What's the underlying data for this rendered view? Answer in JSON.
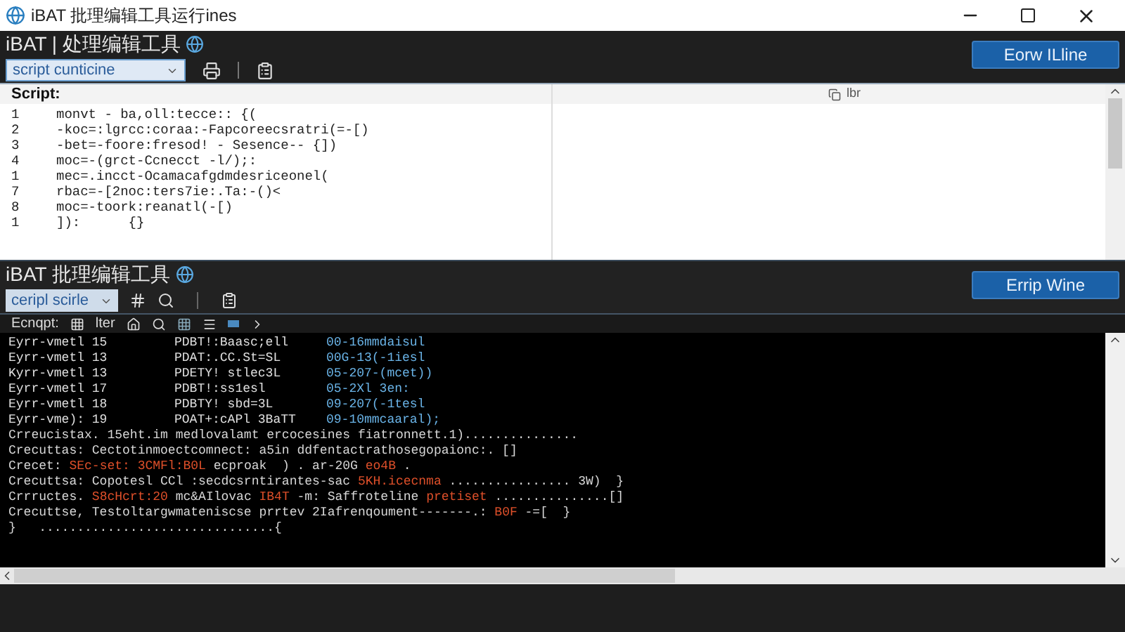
{
  "window": {
    "title": "iBAT 批理编辑工具运行ines"
  },
  "header": {
    "title": "iBAT | 处理编辑工具",
    "button": "Eorw ILline",
    "dropdown": "script cunticine"
  },
  "editor": {
    "label": "Script:",
    "side_label": "lbr",
    "lines": [
      {
        "number": "1",
        "code": "monvt - ba,oll:tecce:: {("
      },
      {
        "number": "2",
        "code": "-koc=:lgrcc:coraa:-Fapcoreecsratri(=-[)"
      },
      {
        "number": "3",
        "code": "-bet=-foore:fresod! - Sesence-- {])"
      },
      {
        "number": "4",
        "code": "moc=-(grct-Ccnecct -l/);:"
      },
      {
        "number": "1",
        "code": "mec=.incct-Ocamacafgdmdesriceonel("
      },
      {
        "number": "7",
        "code": "rbac=-[2noc:ters7ie:.Ta:-()<"
      },
      {
        "number": "8",
        "code": "moc=-toork:reanatl(-[)"
      },
      {
        "number": "1",
        "code": "]):      {}"
      }
    ]
  },
  "console_panel": {
    "title": "iBAT 批理编辑工具",
    "dropdown": "ceripl scirle",
    "button": "Errip Wine",
    "toolbar_label": "Ecnqpt:",
    "filter_label": "lter",
    "rows": [
      {
        "cells": [
          "Eyrr-vmetl 15",
          "PDBT!:Baasc;ell",
          "00-16mmdaisul"
        ]
      },
      {
        "cells": [
          "Eyrr-vmetl 13",
          "PDAT:.CC.St=SL",
          "00G-13(-1iesl"
        ]
      },
      {
        "cells": [
          "Kyrr-vmetl 13",
          "PDETY! stlec3L",
          "05-207-(mcet))"
        ]
      },
      {
        "cells": [
          "Eyrr-vmetl 17",
          "PDBT!:ss1esl",
          "05-2Xl 3en:"
        ]
      },
      {
        "cells": [
          "Eyrr-vmetl 18",
          "PDBTY! sbd=3L",
          "09-207(-1tesl"
        ]
      },
      {
        "cells": [
          "Eyrr-vme): 19",
          "POAT+:cAPl 3BaTT",
          "09-10mmcaaral);"
        ]
      }
    ],
    "lines": [
      {
        "segments": [
          {
            "text": "Crreucistax. 15eht.im medlovalamt ercocesines fiatronnett.1)...............",
            "kind": "plain"
          }
        ]
      },
      {
        "segments": [
          {
            "text": "Crecuttas: Cectotinmoectcomnect: a5in ddfentactrathosegopaionc:. []",
            "kind": "plain"
          }
        ]
      },
      {
        "segments": [
          {
            "text": "Crecet:",
            "kind": "plain"
          },
          {
            "text": "SEc-set:",
            "kind": "error"
          },
          {
            "text": "3CMFl:B0L",
            "kind": "error"
          },
          {
            "text": "ecproak  ) . ar-20G",
            "kind": "plain"
          },
          {
            "text": "eo4B",
            "kind": "error"
          },
          {
            "text": ".",
            "kind": "plain"
          }
        ]
      },
      {
        "segments": [
          {
            "text": "Crecuttsa: Copotesl CCl :secdcsrntirantes-sac",
            "kind": "plain"
          },
          {
            "text": "5KH.icecnma",
            "kind": "error"
          },
          {
            "text": "................ 3W)  }",
            "kind": "plain"
          }
        ]
      },
      {
        "segments": [
          {
            "text": "Crrructes.",
            "kind": "plain"
          },
          {
            "text": "S8cHcrt:20",
            "kind": "error"
          },
          {
            "text": "mc&AIlovac",
            "kind": "plain"
          },
          {
            "text": "IB4T",
            "kind": "error"
          },
          {
            "text": "-m: Saffroteline",
            "kind": "plain"
          },
          {
            "text": "pretiset",
            "kind": "error"
          },
          {
            "text": "...............[]",
            "kind": "plain"
          }
        ]
      },
      {
        "segments": [
          {
            "text": "Crecuttse, Testoltargwmateniscse prrtev 2Iafrenqoument-------.:",
            "kind": "plain"
          },
          {
            "text": "B0F",
            "kind": "error"
          },
          {
            "text": "-=[  }",
            "kind": "plain"
          }
        ]
      },
      {
        "segments": [
          {
            "text": "}   ...............................{",
            "kind": "plain"
          }
        ]
      }
    ]
  }
}
